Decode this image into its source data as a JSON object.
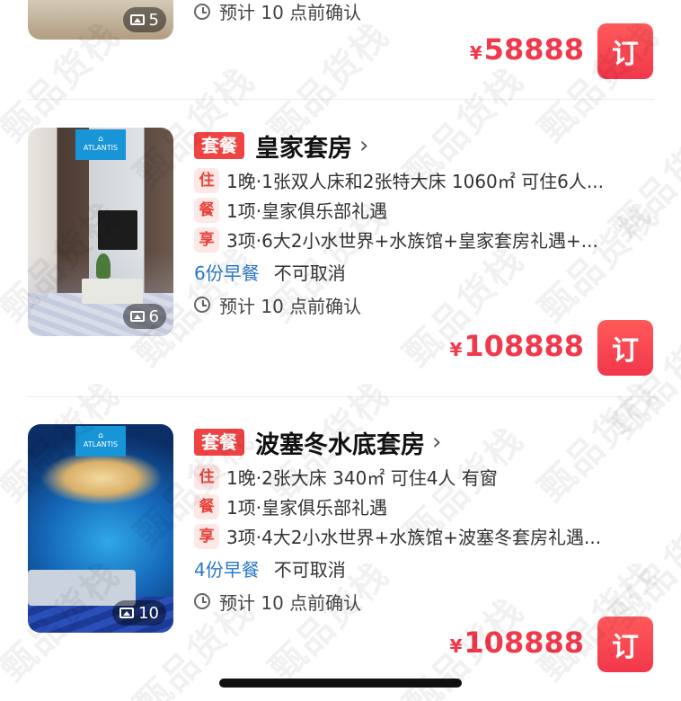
{
  "top_card": {
    "photo_count": "5",
    "confirm_text": "预计 10 点前确认",
    "price": "58888",
    "currency": "¥",
    "book_label": "订"
  },
  "rooms": [
    {
      "tag": "套餐",
      "name": "皇家套房",
      "chevron": "›",
      "stay_chip": "住",
      "stay_text": "1晚·1张双人床和2张特大床 1060㎡ 可住6人...",
      "meal_chip": "餐",
      "meal_text": "1项·皇家俱乐部礼遇",
      "enjoy_chip": "享",
      "enjoy_text": "3项·6大2小水世界+水族馆+皇家套房礼遇+...",
      "breakfast": "6份早餐",
      "cancel_policy": "不可取消",
      "confirm_text": "预计 10 点前确认",
      "photo_count": "6",
      "currency": "¥",
      "price": "108888",
      "book_label": "订",
      "logo_text": "ATLANTIS"
    },
    {
      "tag": "套餐",
      "name": "波塞冬水底套房",
      "chevron": "›",
      "stay_chip": "住",
      "stay_text": "1晚·2张大床 340㎡ 可住4人 有窗",
      "meal_chip": "餐",
      "meal_text": "1项·皇家俱乐部礼遇",
      "enjoy_chip": "享",
      "enjoy_text": "3项·4大2小水世界+水族馆+波塞冬套房礼遇...",
      "breakfast": "4份早餐",
      "cancel_policy": "不可取消",
      "confirm_text": "预计 10 点前确认",
      "photo_count": "10",
      "currency": "¥",
      "price": "108888",
      "book_label": "订",
      "logo_text": "ATLANTIS"
    }
  ],
  "watermark": "甄品货栈",
  "colors": {
    "accent_red": "#f1394c",
    "tag_red": "#f04343",
    "chip_bg": "#fde8e6",
    "meal_blue": "#2a79c6"
  },
  "icons": {
    "photo": "image-icon",
    "clock": "clock-icon",
    "chevron": "chevron-right-icon"
  }
}
